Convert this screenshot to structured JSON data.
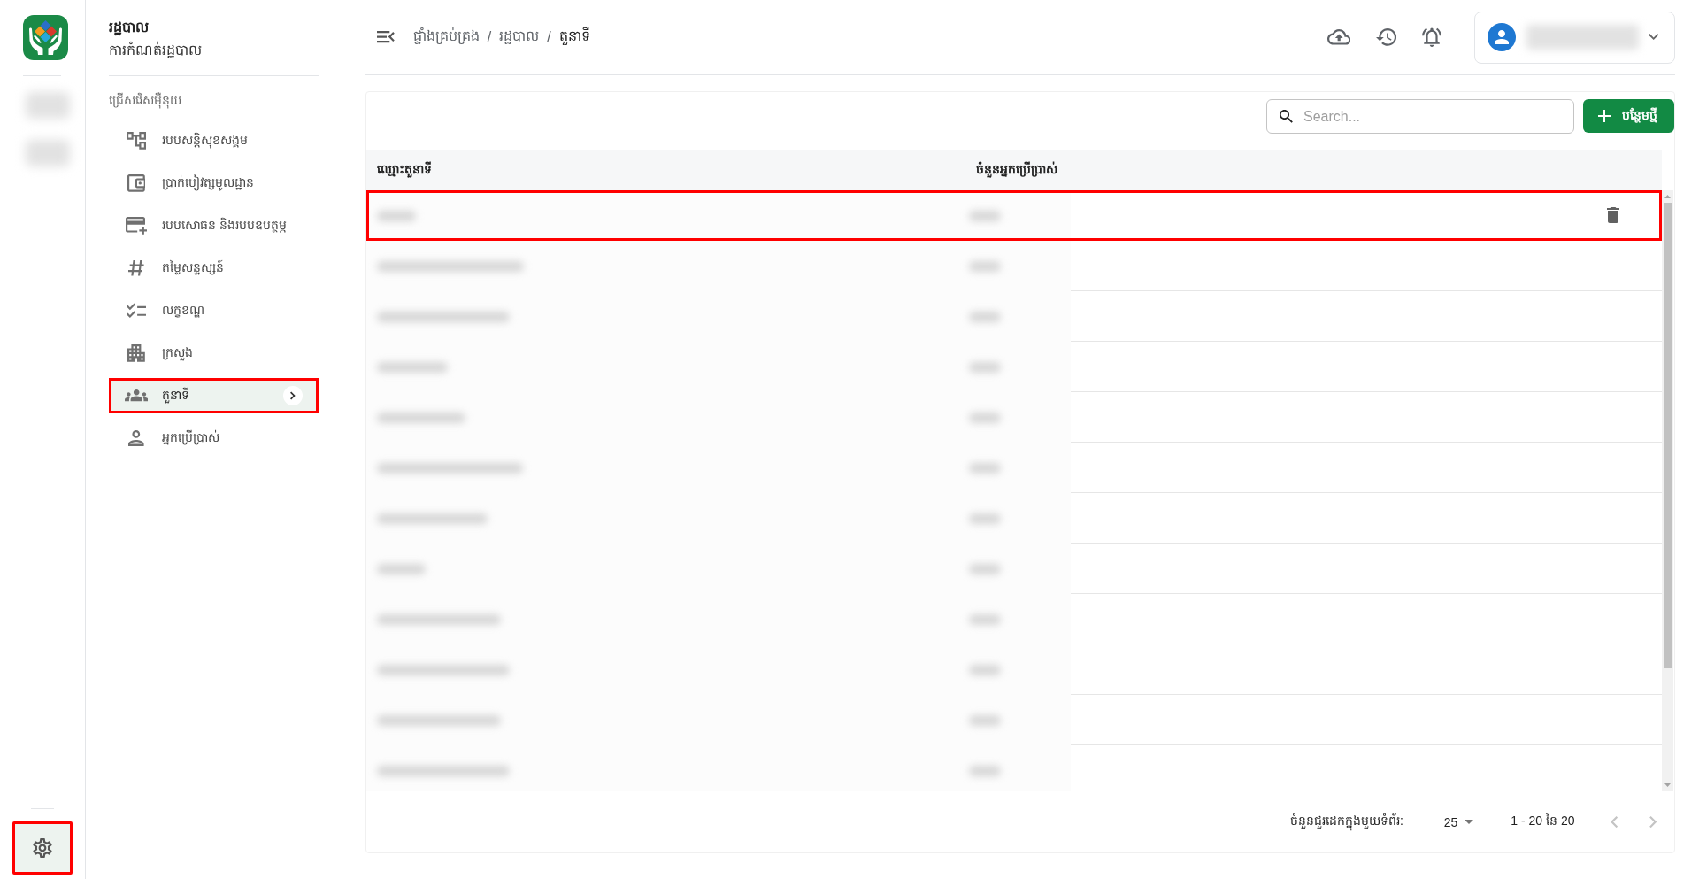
{
  "rail": {
    "items": [
      {
        "selected": false
      },
      {
        "selected": false
      }
    ],
    "settings": {
      "selected": true,
      "highlighted": true
    }
  },
  "sidebar": {
    "title": "រដ្ឋបាល",
    "subtitle": "ការកំណត់រដ្ឋបាល",
    "section_label": "ជ្រើសរើសម៉ឺនុយ",
    "items": [
      {
        "label": "របបសន្តិសុខសង្គម",
        "selected": false,
        "highlighted": false
      },
      {
        "label": "ប្រាក់បៀវត្សមូលដ្ឋាន",
        "selected": false,
        "highlighted": false
      },
      {
        "label": "របបសោធន និងរបបឧបត្ថម្ភ",
        "selected": false,
        "highlighted": false
      },
      {
        "label": "តម្លៃសន្ទស្សន៍",
        "selected": false,
        "highlighted": false
      },
      {
        "label": "លក្ខខណ្ឌ",
        "selected": false,
        "highlighted": false
      },
      {
        "label": "ក្រសួង",
        "selected": false,
        "highlighted": false
      },
      {
        "label": "តួនាទី",
        "selected": true,
        "highlighted": true
      },
      {
        "label": "អ្នកប្រើប្រាស់",
        "selected": false,
        "highlighted": false
      }
    ]
  },
  "topbar": {
    "breadcrumb": [
      {
        "label": "ផ្ទាំងគ្រប់គ្រង",
        "current": false
      },
      {
        "label": "រដ្ឋបាល",
        "current": false
      },
      {
        "label": "តួនាទី",
        "current": true
      }
    ],
    "separators": [
      "/",
      "/"
    ]
  },
  "toolbar": {
    "search": {
      "placeholder": "Search..."
    },
    "add_button": {
      "label": "បន្ថែមថ្មី"
    }
  },
  "table": {
    "columns": [
      "ឈ្មោះតួនាទី",
      "ចំនួនអ្នកប្រើប្រាស់"
    ],
    "rows": [
      {
        "hovered": true,
        "highlighted": true
      },
      {
        "hovered": false,
        "highlighted": false
      },
      {
        "hovered": false,
        "highlighted": false
      },
      {
        "hovered": false,
        "highlighted": false
      },
      {
        "hovered": false,
        "highlighted": false
      },
      {
        "hovered": false,
        "highlighted": false
      },
      {
        "hovered": false,
        "highlighted": false
      },
      {
        "hovered": false,
        "highlighted": false
      },
      {
        "hovered": false,
        "highlighted": false
      },
      {
        "hovered": false,
        "highlighted": false
      },
      {
        "hovered": false,
        "highlighted": false
      },
      {
        "hovered": false,
        "highlighted": false
      }
    ]
  },
  "pagination": {
    "rows_per_page_label": "ចំនួនជួរដេកក្នុងមួយទំព័រ:",
    "rows_per_page": "25",
    "range": "1 - 20 នៃ 20",
    "prev_disabled": true,
    "next_disabled": true
  }
}
